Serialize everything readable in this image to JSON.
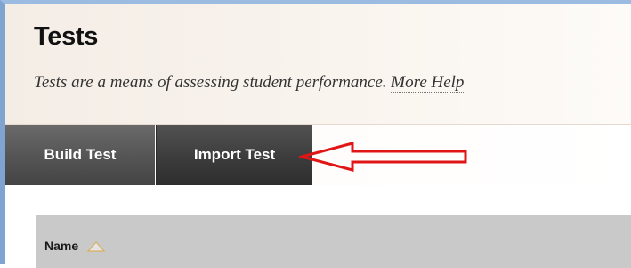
{
  "page": {
    "title": "Tests",
    "description": "Tests are a means of assessing student performance.",
    "help_link": "More Help"
  },
  "toolbar": {
    "build_test_label": "Build Test",
    "import_test_label": "Import Test"
  },
  "annotation": {
    "arrow_icon": "left-arrow-icon",
    "arrow_color": "#e01616"
  },
  "table": {
    "columns": [
      {
        "label": "Name",
        "sort_icon": "sort-ascending-icon"
      }
    ]
  },
  "colors": {
    "frame_border": "#7ea4cf",
    "toolbar_button": "#4a4a4a",
    "table_header": "#c9c9c9"
  }
}
